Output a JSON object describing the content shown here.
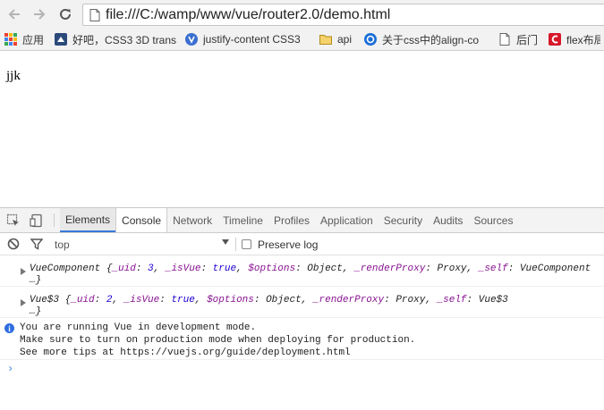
{
  "browser": {
    "url": "file:///C:/wamp/www/vue/router2.0/demo.html"
  },
  "bookmarks": [
    {
      "label": "应用",
      "icon": "apps-grid-icon"
    },
    {
      "label": "好吧，CSS3 3D trans",
      "icon": "site-favicon-icon"
    },
    {
      "label": "justify-content CSS3",
      "icon": "site-favicon-icon"
    },
    {
      "label": "api",
      "icon": "folder-icon"
    },
    {
      "label": "关于css中的align-co",
      "icon": "site-favicon-icon"
    },
    {
      "label": "后门",
      "icon": "page-icon"
    },
    {
      "label": "flex布局",
      "icon": "site-favicon-icon"
    }
  ],
  "page": {
    "text": "jjk"
  },
  "devtools": {
    "tabs": [
      "Elements",
      "Console",
      "Network",
      "Timeline",
      "Profiles",
      "Application",
      "Security",
      "Audits",
      "Sources"
    ],
    "active_tab": "Console",
    "filter": {
      "context": "top",
      "preserve_log": "Preserve log"
    },
    "log": {
      "obj1": {
        "name": "VueComponent",
        "open": " {",
        "k_uid": "_uid",
        "v_uid": "3",
        "k_isVue": "_isVue",
        "v_isVue": "true",
        "k_options": "$options",
        "v_options": "Object",
        "k_renderProxy": "_renderProxy",
        "v_renderProxy": "Proxy",
        "k_self": "_self",
        "v_self": "VueComponent",
        "tail": "…}"
      },
      "obj2": {
        "name": "Vue$3",
        "open": " {",
        "k_uid": "_uid",
        "v_uid": "2",
        "k_isVue": "_isVue",
        "v_isVue": "true",
        "k_options": "$options",
        "v_options": "Object",
        "k_renderProxy": "_renderProxy",
        "v_renderProxy": "Proxy",
        "k_self": "_self",
        "v_self": "Vue$3",
        "tail": "…}"
      },
      "info": {
        "line1": "You are running Vue in development mode.",
        "line2": "Make sure to turn on production mode when deploying for production.",
        "line3": "See more tips at https://vuejs.org/guide/deployment.html"
      }
    }
  },
  "colors": {
    "accent": "#3879d9",
    "key": "#881391",
    "value": "#1c00cf"
  }
}
